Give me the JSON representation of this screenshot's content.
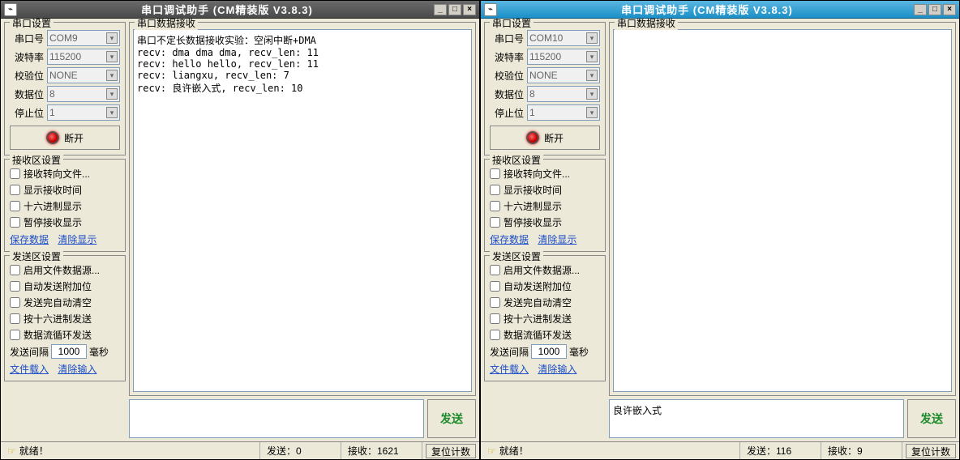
{
  "windows": [
    {
      "title": "串口调试助手 (CM精装版 V3.8.3)",
      "theme": "w1",
      "port_settings": {
        "legend": "串口设置",
        "port_label": "串口号",
        "port_value": "COM9",
        "baud_label": "波特率",
        "baud_value": "115200",
        "parity_label": "校验位",
        "parity_value": "NONE",
        "data_label": "数据位",
        "data_value": "8",
        "stop_label": "停止位",
        "stop_value": "1",
        "disconnect": "断开"
      },
      "recv_settings": {
        "legend": "接收区设置",
        "c1": "接收转向文件...",
        "c2": "显示接收时间",
        "c3": "十六进制显示",
        "c4": "暂停接收显示",
        "save": "保存数据",
        "clear": "清除显示"
      },
      "send_settings": {
        "legend": "发送区设置",
        "c1": "启用文件数据源...",
        "c2": "自动发送附加位",
        "c3": "发送完自动清空",
        "c4": "按十六进制发送",
        "c5": "数据流循环发送",
        "interval_label": "发送间隔",
        "interval_value": "1000",
        "interval_unit": "毫秒",
        "file": "文件载入",
        "clear": "清除输入"
      },
      "recv_area": {
        "legend": "串口数据接收",
        "text": "串口不定长数据接收实验：空闲中断+DMA\nrecv: dma dma dma, recv_len: 11\nrecv: hello hello, recv_len: 11\nrecv: liangxu, recv_len: 7\nrecv: 良许嵌入式, recv_len: 10"
      },
      "send_input": "",
      "send_btn": "发送",
      "status": {
        "ready": "就绪！",
        "sent": "发送：0",
        "recv": "接收：1621",
        "reset": "复位计数"
      }
    },
    {
      "title": "串口调试助手 (CM精装版 V3.8.3)",
      "theme": "w2",
      "port_settings": {
        "legend": "串口设置",
        "port_label": "串口号",
        "port_value": "COM10",
        "baud_label": "波特率",
        "baud_value": "115200",
        "parity_label": "校验位",
        "parity_value": "NONE",
        "data_label": "数据位",
        "data_value": "8",
        "stop_label": "停止位",
        "stop_value": "1",
        "disconnect": "断开"
      },
      "recv_settings": {
        "legend": "接收区设置",
        "c1": "接收转向文件...",
        "c2": "显示接收时间",
        "c3": "十六进制显示",
        "c4": "暂停接收显示",
        "save": "保存数据",
        "clear": "清除显示"
      },
      "send_settings": {
        "legend": "发送区设置",
        "c1": "启用文件数据源...",
        "c2": "自动发送附加位",
        "c3": "发送完自动清空",
        "c4": "按十六进制发送",
        "c5": "数据流循环发送",
        "interval_label": "发送间隔",
        "interval_value": "1000",
        "interval_unit": "毫秒",
        "file": "文件载入",
        "clear": "清除输入"
      },
      "recv_area": {
        "legend": "串口数据接收",
        "text": ""
      },
      "send_input": "良许嵌入式",
      "send_btn": "发送",
      "status": {
        "ready": "就绪！",
        "sent": "发送：116",
        "recv": "接收：9",
        "reset": "复位计数"
      }
    }
  ]
}
